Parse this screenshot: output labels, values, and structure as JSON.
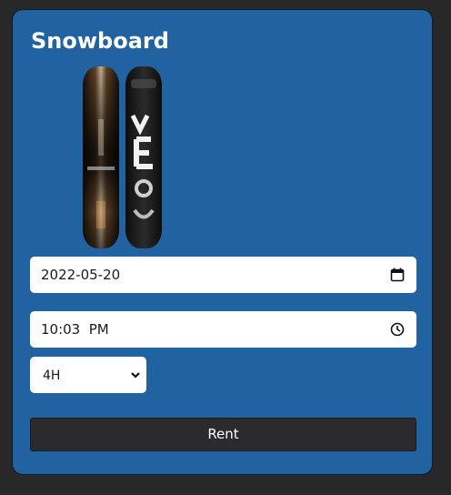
{
  "card": {
    "title": "Snowboard"
  },
  "form": {
    "date_value": "2022-05-20",
    "time_value": "10:03  PM",
    "duration_selected": "4H",
    "rent_label": "Rent"
  },
  "icons": {
    "date": "calendar-icon",
    "time": "clock-icon",
    "select": "chevron-down-icon"
  },
  "colors": {
    "page_background": "#292829",
    "card_background": "#2063a0",
    "button_background": "#2b2a2c",
    "text_on_card": "#ffffff"
  }
}
